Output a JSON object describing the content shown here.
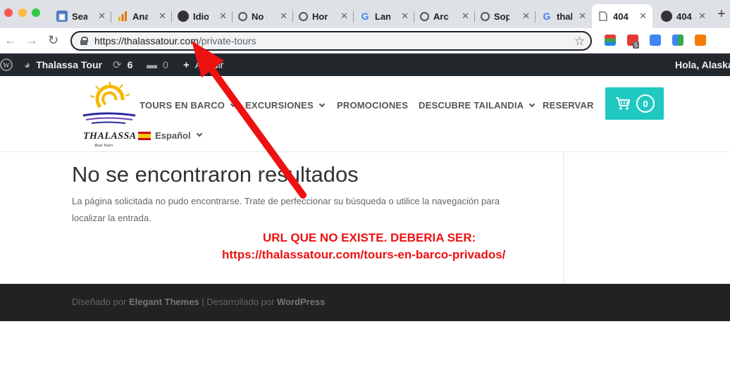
{
  "browser": {
    "tabs": [
      {
        "title": "Sea",
        "icon": "search-console-icon",
        "active": false
      },
      {
        "title": "Ana",
        "icon": "analytics-icon",
        "active": false
      },
      {
        "title": "Idio",
        "icon": "github-icon",
        "active": false
      },
      {
        "title": "No s",
        "icon": "wordpress-support-icon",
        "active": false
      },
      {
        "title": "Hon",
        "icon": "wordpress-support-icon",
        "active": false
      },
      {
        "title": "Lan",
        "icon": "google-icon",
        "active": false
      },
      {
        "title": "Arch",
        "icon": "wordpress-support-icon",
        "active": false
      },
      {
        "title": "Sop",
        "icon": "wordpress-support-icon",
        "active": false
      },
      {
        "title": "thal",
        "icon": "google-icon",
        "active": false
      },
      {
        "title": "404",
        "icon": "page-icon",
        "active": true
      },
      {
        "title": "404",
        "icon": "github-icon",
        "active": false
      }
    ],
    "url_domain": "https://thalassatour.com",
    "url_path": "/private-tours",
    "extension_badge": "5"
  },
  "adminbar": {
    "site_name": "Thalassa Tour",
    "updates_count": "6",
    "comments_count": "0",
    "new_label": "Añadir",
    "greeting": "Hola, Alaska"
  },
  "header": {
    "logo_text": "THALASSA",
    "logo_subtext": "Boat Tours",
    "nav": [
      {
        "label": "TOURS EN BARCO",
        "has_dropdown": true
      },
      {
        "label": "EXCURSIONES",
        "has_dropdown": true
      },
      {
        "label": "PROMOCIONES",
        "has_dropdown": false
      },
      {
        "label": "DESCUBRE TAILANDIA",
        "has_dropdown": true
      },
      {
        "label": "RESERVAR",
        "has_dropdown": false
      }
    ],
    "language": "Español",
    "cart_count": "0",
    "accent_color": "#1fc9c1"
  },
  "content": {
    "title": "No se encontraron resultados",
    "message": "La página solicitada no pudo encontrarse. Trate de perfeccionar su búsqueda o utilice la navegación para localizar la entrada.",
    "annotation_line1": "URL QUE NO EXISTE. DEBERIA SER:",
    "annotation_line2": "https://thalassatour.com/tours-en-barco-privados/",
    "annotation_color": "#ee1111"
  },
  "footer": {
    "designed_prefix": "Diseñado por ",
    "designed_by": "Elegant Themes",
    "separator": " | Desarrollado por ",
    "powered_by": "WordPress"
  }
}
